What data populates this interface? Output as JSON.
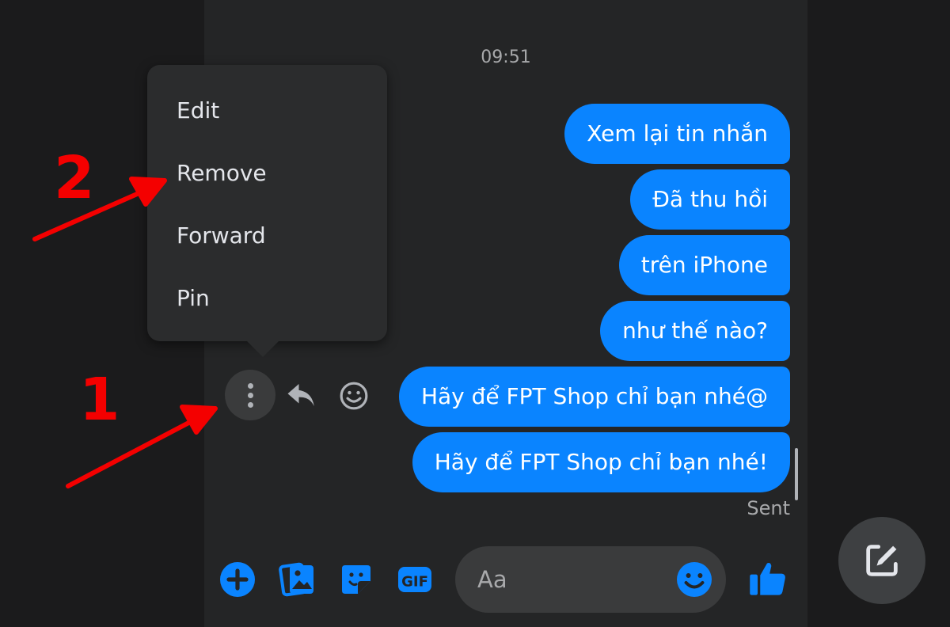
{
  "chat": {
    "time": "09:51",
    "messages": [
      "Xem lại tin nhắn",
      "Đã thu hồi",
      "trên iPhone",
      "như thế nào?",
      "Hãy để FPT Shop chỉ bạn nhé@",
      "Hãy để FPT Shop chỉ bạn nhé!"
    ],
    "status": "Sent",
    "bubble_color": "#0a84ff"
  },
  "menu": {
    "items": [
      "Edit",
      "Remove",
      "Forward",
      "Pin"
    ]
  },
  "message_actions": {
    "icons": [
      "more-vertical-icon",
      "reply-icon",
      "emoji-react-icon"
    ]
  },
  "composer": {
    "placeholder": "Aa",
    "icons": [
      "plus-icon",
      "photo-icon",
      "sticker-icon",
      "gif-icon",
      "emoji-icon",
      "thumbs-up-icon"
    ],
    "gif_label": "GIF"
  },
  "annotations": {
    "step1": "1",
    "step2": "2",
    "color": "#f40000"
  }
}
